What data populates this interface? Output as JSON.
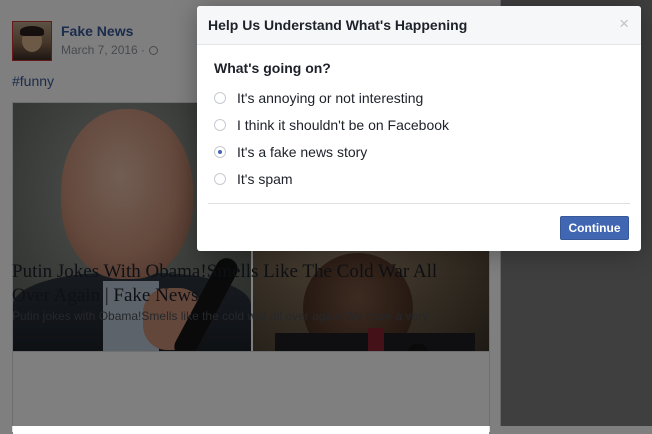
{
  "post": {
    "page_name": "Fake News",
    "date": "March 7, 2016 ·",
    "hashtag": "#funny",
    "article_title": "Putin Jokes With Obama!Smells Like The Cold War All Over Again | Fake News",
    "article_description": "Putin jokes with Obama!Smells like the cold war all over again We have a very"
  },
  "dialog": {
    "title": "Help Us Understand What's Happening",
    "close_glyph": "×",
    "question": "What's going on?",
    "options": [
      {
        "label": "It's annoying or not interesting",
        "checked": false
      },
      {
        "label": "I think it shouldn't be on Facebook",
        "checked": false
      },
      {
        "label": "It's a fake news story",
        "checked": true
      },
      {
        "label": "It's spam",
        "checked": false
      }
    ],
    "continue_label": "Continue"
  },
  "colors": {
    "link_blue": "#365899",
    "button_blue": "#4267b2",
    "overlay": "rgba(0,0,0,0.5)"
  }
}
